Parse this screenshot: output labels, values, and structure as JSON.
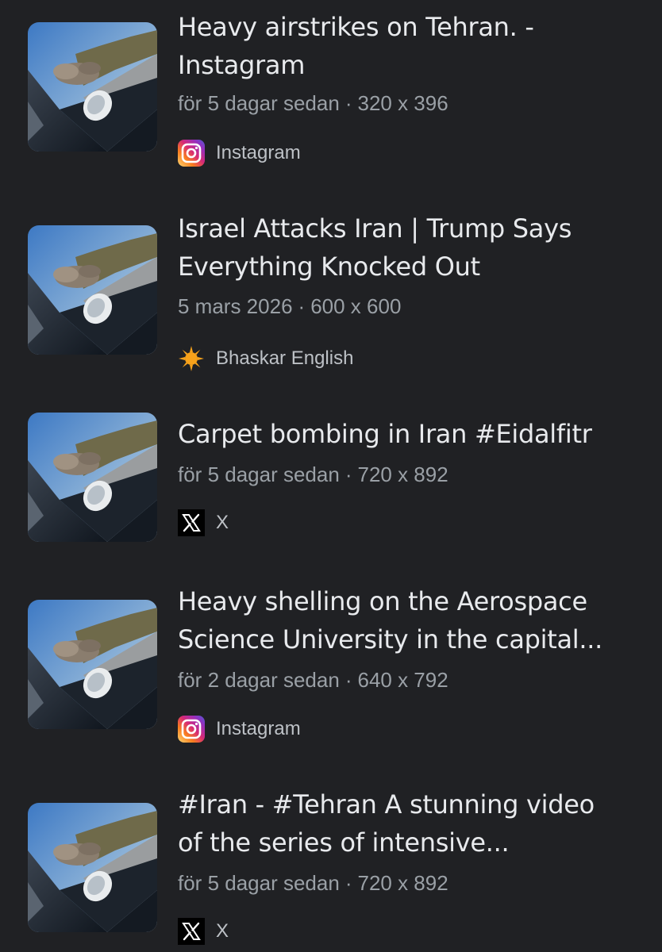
{
  "results": [
    {
      "title_lines": [
        "Heavy airstrikes on Tehran. -",
        "Instagram"
      ],
      "date": "för 5 dagar sedan",
      "separator": "·",
      "dimensions": "320 x 396",
      "source": "Instagram",
      "source_icon": "instagram-icon",
      "thumbnail": "video-thumbnail"
    },
    {
      "title_lines": [
        "Israel Attacks Iran | Trump Says",
        "Everything Knocked Out"
      ],
      "date": "5 mars 2026",
      "separator": "·",
      "dimensions": "600 x 600",
      "source": "Bhaskar English",
      "source_icon": "bhaskar-sun-icon",
      "thumbnail": "video-thumbnail"
    },
    {
      "title_lines": [
        "Carpet bombing in Iran #Eidalfitr"
      ],
      "date": "för 5 dagar sedan",
      "separator": "·",
      "dimensions": "720 x 892",
      "source": "X",
      "source_icon": "x-logo-icon",
      "thumbnail": "video-thumbnail"
    },
    {
      "title_lines": [
        "Heavy shelling on the Aerospace",
        "Science University in the capital..."
      ],
      "date": "för 2 dagar sedan",
      "separator": "·",
      "dimensions": "640 x 792",
      "source": "Instagram",
      "source_icon": "instagram-icon",
      "thumbnail": "video-thumbnail"
    },
    {
      "title_lines": [
        "#Iran - #Tehran A stunning video",
        "of the series of intensive..."
      ],
      "date": "för 5 dagar sedan",
      "separator": "·",
      "dimensions": "720 x 892",
      "source": "X",
      "source_icon": "x-logo-icon",
      "thumbnail": "video-thumbnail"
    }
  ],
  "colors": {
    "background": "#202124",
    "title": "#e8eaed",
    "meta": "#9aa0a6",
    "source": "#bdc1c6"
  }
}
